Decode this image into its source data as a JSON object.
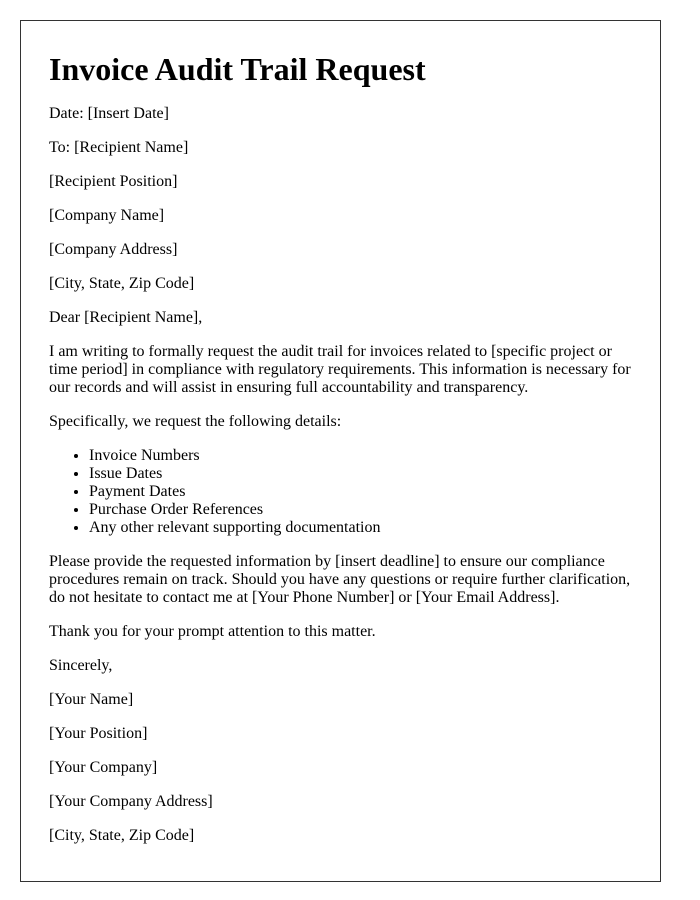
{
  "title": "Invoice Audit Trail Request",
  "header_lines": [
    "Date: [Insert Date]",
    "To: [Recipient Name]",
    "[Recipient Position]",
    "[Company Name]",
    "[Company Address]",
    "[City, State, Zip Code]"
  ],
  "salutation": "Dear [Recipient Name],",
  "body": {
    "para1": "I am writing to formally request the audit trail for invoices related to [specific project or time period] in compliance with regulatory requirements. This information is necessary for our records and will assist in ensuring full accountability and transparency.",
    "para2": "Specifically, we request the following details:",
    "list": [
      "Invoice Numbers",
      "Issue Dates",
      "Payment Dates",
      "Purchase Order References",
      "Any other relevant supporting documentation"
    ],
    "para3": "Please provide the requested information by [insert deadline] to ensure our compliance procedures remain on track. Should you have any questions or require further clarification, do not hesitate to contact me at [Your Phone Number] or [Your Email Address].",
    "para4": "Thank you for your prompt attention to this matter."
  },
  "closing": "Sincerely,",
  "signature_lines": [
    "[Your Name]",
    "[Your Position]",
    "[Your Company]",
    "[Your Company Address]",
    "[City, State, Zip Code]"
  ]
}
